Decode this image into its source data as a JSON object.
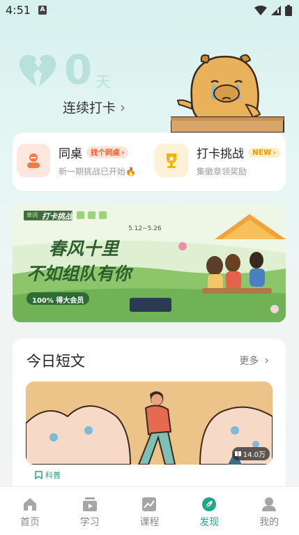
{
  "status_bar": {
    "time": "4:51",
    "notification_letter": "A"
  },
  "streak": {
    "count": "0",
    "unit": "天",
    "link_label": "连续打卡",
    "chevron": "›"
  },
  "features": [
    {
      "title": "同桌",
      "tag": "找个同桌",
      "tag_chevron": "›",
      "subtitle": "新一期挑战已开始🔥"
    },
    {
      "title": "打卡挑战",
      "tag": "NEW",
      "tag_chevron": "›",
      "subtitle": "集徽章领奖励"
    }
  ],
  "banner": {
    "logo": "打卡挑战",
    "logo_prefix": "单词",
    "date": "5.12~5.26",
    "headline_line1": "春风十里",
    "headline_line2": "不如组队有你",
    "sub_button": "100% 得大会员"
  },
  "article_section": {
    "title": "今日短文",
    "more_label": "更多",
    "more_chevron": "›",
    "read_count": "14.0万",
    "category": "科普"
  },
  "tabbar": {
    "items": [
      {
        "label": "首页",
        "icon": "home-icon",
        "active": false
      },
      {
        "label": "学习",
        "icon": "study-icon",
        "active": false
      },
      {
        "label": "课程",
        "icon": "course-icon",
        "active": false
      },
      {
        "label": "发现",
        "icon": "discover-icon",
        "active": true
      },
      {
        "label": "我的",
        "icon": "profile-icon",
        "active": false
      }
    ]
  },
  "colors": {
    "accent": "#1fa784",
    "streak": "#b9e1dc",
    "tag_orange": "#f25c2d"
  }
}
